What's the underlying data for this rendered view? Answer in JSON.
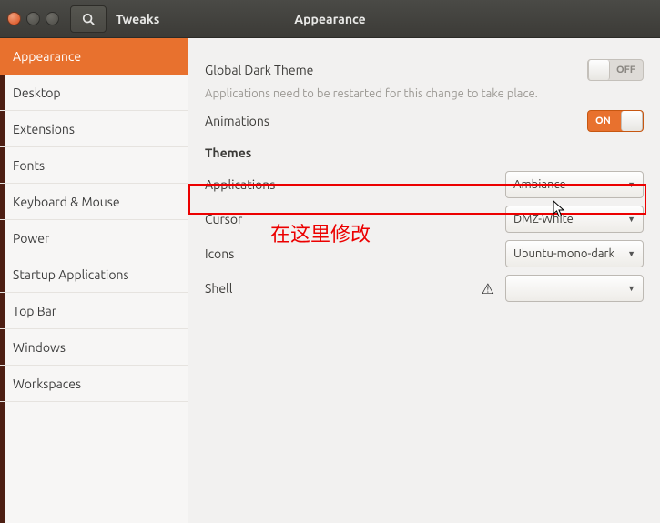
{
  "window": {
    "app_name": "Tweaks",
    "page_title": "Appearance"
  },
  "sidebar": {
    "items": [
      {
        "label": "Appearance",
        "active": true
      },
      {
        "label": "Desktop"
      },
      {
        "label": "Extensions"
      },
      {
        "label": "Fonts"
      },
      {
        "label": "Keyboard & Mouse"
      },
      {
        "label": "Power"
      },
      {
        "label": "Startup Applications"
      },
      {
        "label": "Top Bar"
      },
      {
        "label": "Windows"
      },
      {
        "label": "Workspaces"
      }
    ]
  },
  "main": {
    "dark_theme": {
      "label": "Global Dark Theme",
      "hint": "Applications need to be restarted for this change to take place.",
      "state": "OFF"
    },
    "animations": {
      "label": "Animations",
      "state": "ON"
    },
    "themes_header": "Themes",
    "applications": {
      "label": "Applications",
      "value": "Ambiance"
    },
    "cursor": {
      "label": "Cursor",
      "value": "DMZ-White"
    },
    "icons": {
      "label": "Icons",
      "value": "Ubuntu-mono-dark"
    },
    "shell": {
      "label": "Shell",
      "value": ""
    }
  },
  "annotation": {
    "text": "在这里修改"
  }
}
